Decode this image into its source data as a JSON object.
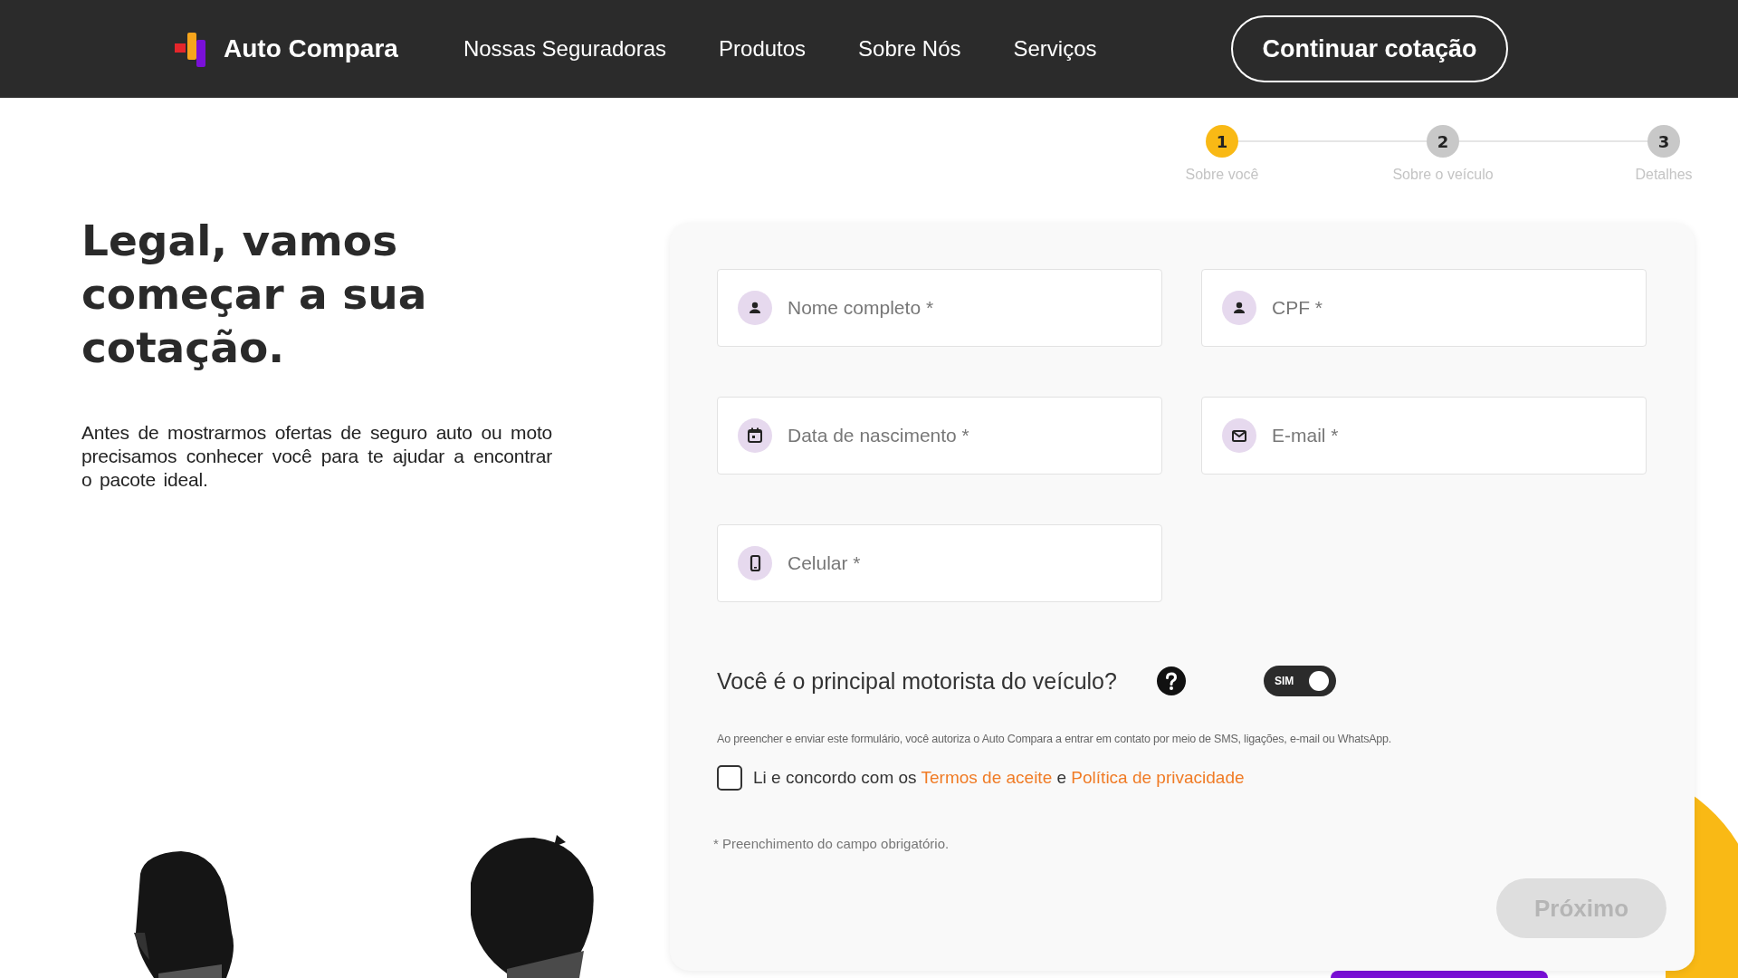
{
  "header": {
    "brand": "Auto Compara",
    "nav": [
      "Nossas Seguradoras",
      "Produtos",
      "Sobre Nós",
      "Serviços"
    ],
    "cta": "Continuar cotação"
  },
  "intro": {
    "title": "Legal, vamos começar a sua cotação.",
    "text": "Antes de mostrarmos ofertas de seguro auto ou moto precisamos conhecer você para te ajudar a encontrar o pacote ideal."
  },
  "steps": [
    {
      "number": "1",
      "label": "Sobre você",
      "selected": true
    },
    {
      "number": "2",
      "label": "Sobre o veículo",
      "selected": false
    },
    {
      "number": "3",
      "label": "Detalhes",
      "selected": false
    }
  ],
  "form": {
    "fields": [
      {
        "kind": "person",
        "placeholder": "Nome completo *"
      },
      {
        "kind": "document",
        "placeholder": "CPF *"
      },
      {
        "kind": "date",
        "placeholder": "Data de nascimento *"
      },
      {
        "kind": "email",
        "placeholder": "E-mail *"
      },
      {
        "kind": "phone",
        "placeholder": "Celular *"
      }
    ],
    "question": "Você é o principal motorista do veículo?",
    "toggle": {
      "label": "SIM",
      "on": true
    },
    "consent": "Ao preencher e enviar este formulário, você autoriza o Auto Compara a entrar em contato por meio de SMS, ligações, e-mail ou WhatsApp.",
    "agree": {
      "checked": false,
      "text": "Li e concordo com os",
      "link1": "Termos de aceite",
      "joiner": "e",
      "link2": "Política de privacidade"
    },
    "footnote": "* Preenchimento do campo obrigatório.",
    "next": {
      "label": "Próximo",
      "disabled": true
    }
  }
}
